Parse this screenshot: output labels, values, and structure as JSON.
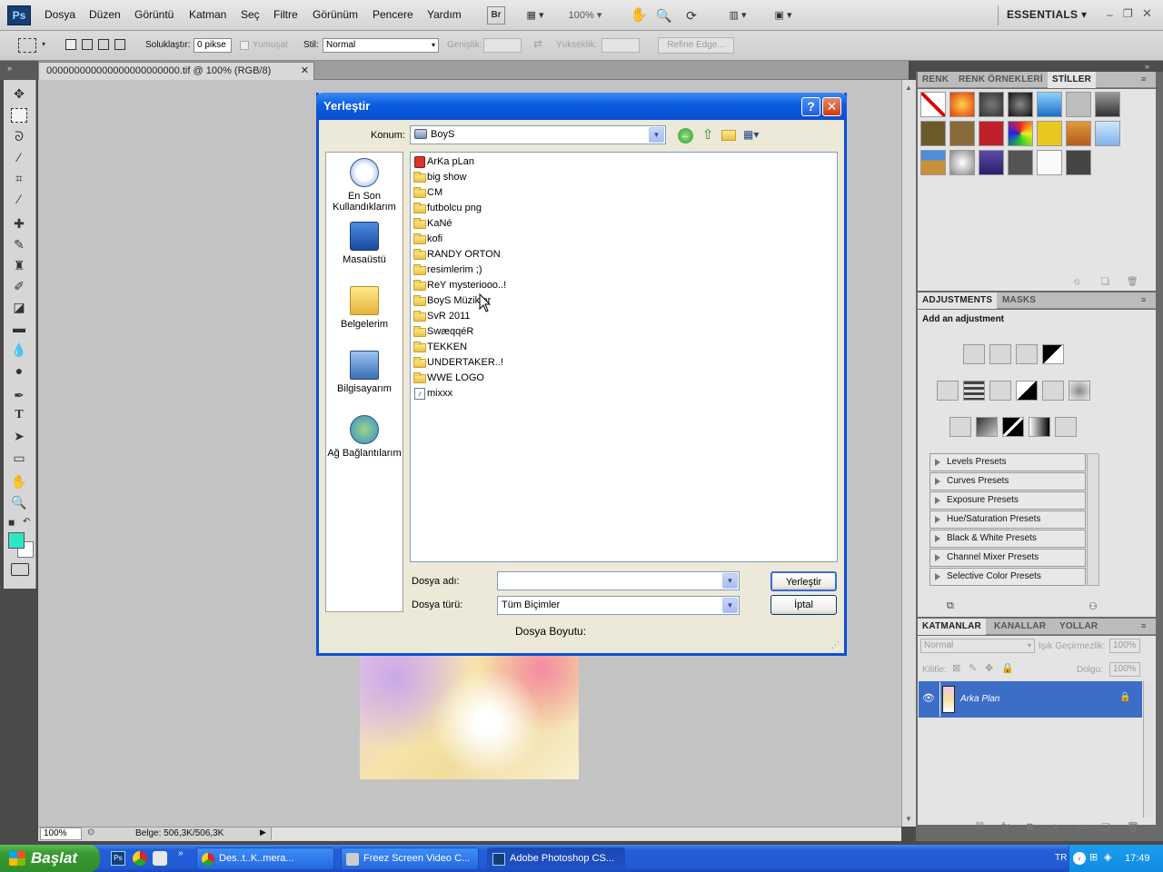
{
  "app": {
    "logo": "Ps"
  },
  "menu": [
    "Dosya",
    "Düzen",
    "Görüntü",
    "Katman",
    "Seç",
    "Filtre",
    "Görünüm",
    "Pencere",
    "Yardım"
  ],
  "toolbar": {
    "bridge": "Br",
    "zoom": "100%",
    "workspace": "ESSENTIALS"
  },
  "options": {
    "feather_label": "Soluklaştır:",
    "feather_value": "0 pikse",
    "antialias_label": "Yumuşat",
    "style_label": "Stil:",
    "style_value": "Normal",
    "width_label": "Genişlik:",
    "height_label": "Yükseklik:",
    "refine_edge": "Refine Edge..."
  },
  "document": {
    "tab_title": "000000000000000000000000.tif @ 100% (RGB/8)",
    "zoom": "100%",
    "doc_info": "Belge: 506,3K/506,3K"
  },
  "panels": {
    "styles_tabs": [
      "RENK",
      "RENK ÖRNEKLERİ",
      "STİLLER"
    ],
    "adjust_tabs": [
      "ADJUSTMENTS",
      "MASKS"
    ],
    "add_adjustment": "Add an adjustment",
    "presets": [
      "Levels Presets",
      "Curves Presets",
      "Exposure Presets",
      "Hue/Saturation Presets",
      "Black & White Presets",
      "Channel Mixer Presets",
      "Selective Color Presets"
    ],
    "layers_tabs": [
      "KATMANLAR",
      "KANALLAR",
      "YOLLAR"
    ],
    "blend_mode": "Normal",
    "opacity_label": "Işık Geçirmezlik:",
    "opacity_value": "100%",
    "lock_label": "Kilitle:",
    "fill_label": "Dolgu:",
    "fill_value": "100%",
    "layer_name": "Arka Plan"
  },
  "dialog": {
    "title": "Yerleştir",
    "look_in_label": "Konum:",
    "look_in_value": "BoyS",
    "places": [
      {
        "label": "En Son Kullandıklarım",
        "icon": "recent-icon"
      },
      {
        "label": "Masaüstü",
        "icon": "desktop-icon"
      },
      {
        "label": "Belgelerim",
        "icon": "documents-icon"
      },
      {
        "label": "Bilgisayarım",
        "icon": "computer-icon"
      },
      {
        "label": "Ağ Bağlantılarım",
        "icon": "network-icon"
      }
    ],
    "files": [
      {
        "name": "ArKa pLan",
        "type": "psd"
      },
      {
        "name": "big show",
        "type": "folder"
      },
      {
        "name": "CM",
        "type": "folder"
      },
      {
        "name": "futbolcu png",
        "type": "folder"
      },
      {
        "name": "KaNé",
        "type": "folder"
      },
      {
        "name": "kofi",
        "type": "folder"
      },
      {
        "name": "RANDY ORTON",
        "type": "folder"
      },
      {
        "name": "resimlerim ;)",
        "type": "folder"
      },
      {
        "name": "ReY mysteriooo..!",
        "type": "folder"
      },
      {
        "name": "BoyS Müzikler",
        "type": "folder"
      },
      {
        "name": "SvR 2011",
        "type": "folder"
      },
      {
        "name": "SwæqqéR",
        "type": "folder"
      },
      {
        "name": "TEKKEN",
        "type": "folder"
      },
      {
        "name": "UNDERTAKER..!",
        "type": "folder"
      },
      {
        "name": "WWE LOGO",
        "type": "folder"
      },
      {
        "name": "mixxx",
        "type": "audio"
      }
    ],
    "filename_label": "Dosya adı:",
    "filename_value": "",
    "filetype_label": "Dosya türü:",
    "filetype_value": "Tüm Biçimler",
    "filesize_label": "Dosya Boyutu:",
    "place_button": "Yerleştir",
    "cancel_button": "İptal"
  },
  "taskbar": {
    "start": "Başlat",
    "tasks": [
      "Des..t..K..mera...",
      "Freez Screen Video C...",
      "Adobe Photoshop CS..."
    ],
    "lang": "TR",
    "clock": "17:49"
  }
}
